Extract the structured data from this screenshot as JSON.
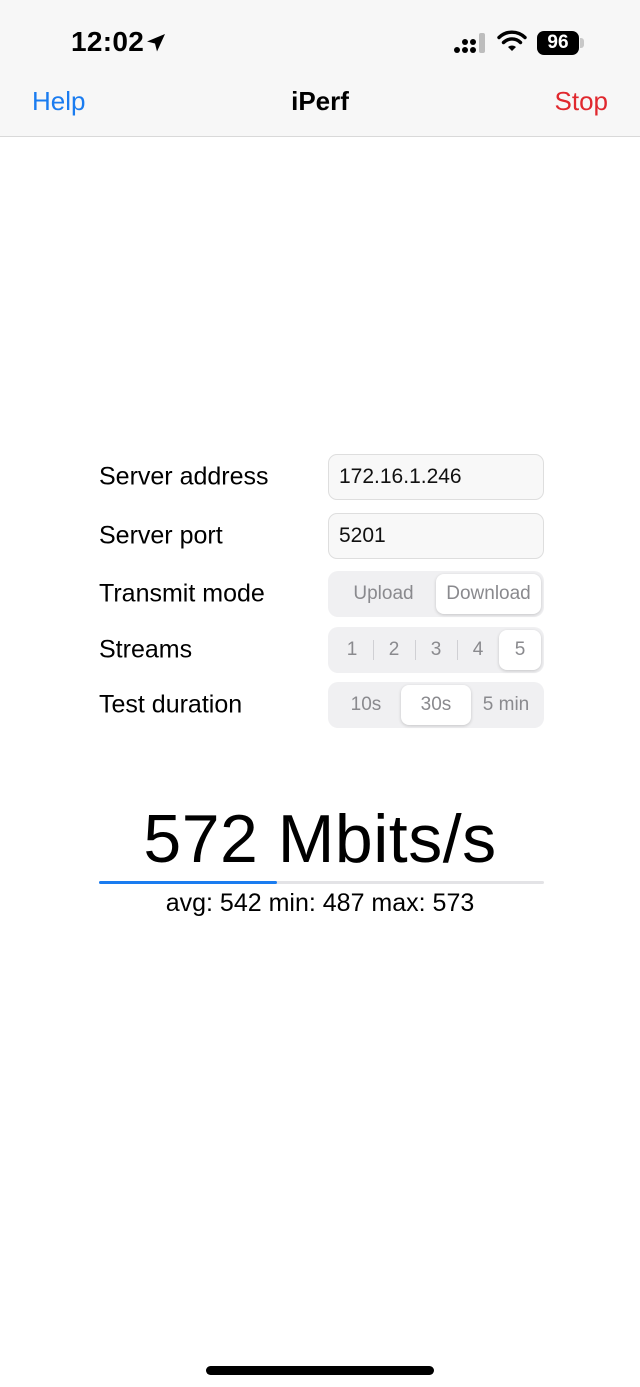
{
  "status_bar": {
    "time": "12:02",
    "battery": "96",
    "icons": [
      "location-arrow-icon",
      "cellular-signal-icon",
      "wifi-icon",
      "battery-icon"
    ]
  },
  "nav": {
    "left": "Help",
    "title": "iPerf",
    "right": "Stop",
    "colors": {
      "link": "#1a7cf0",
      "stop": "#e0282e"
    }
  },
  "form": {
    "server_address": {
      "label": "Server address",
      "value": "172.16.1.246"
    },
    "server_port": {
      "label": "Server port",
      "value": "5201"
    },
    "transmit_mode": {
      "label": "Transmit mode",
      "options": [
        "Upload",
        "Download"
      ],
      "selected": "Download"
    },
    "streams": {
      "label": "Streams",
      "options": [
        "1",
        "2",
        "3",
        "4",
        "5"
      ],
      "selected": "5"
    },
    "test_duration": {
      "label": "Test duration",
      "options": [
        "10s",
        "30s",
        "5 min"
      ],
      "selected": "30s"
    }
  },
  "result": {
    "speed": "572 Mbits/s",
    "stats": "avg: 542 min: 487 max: 573",
    "progress": 0.4
  }
}
